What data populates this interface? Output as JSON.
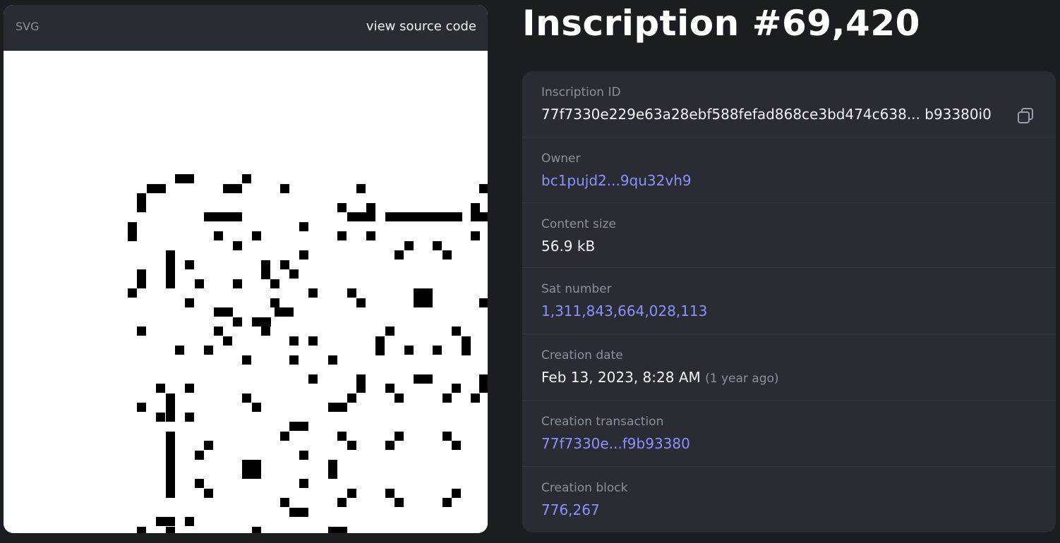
{
  "preview": {
    "type_label": "SVG",
    "source_link": "view source code"
  },
  "title": "Inscription #69,420",
  "details": {
    "inscription_id": {
      "label": "Inscription ID",
      "value": "77f7330e229e63a28ebf588fefad868ce3bd474c638... b93380i0"
    },
    "owner": {
      "label": "Owner",
      "value": "bc1pujd2...9qu32vh9"
    },
    "content_size": {
      "label": "Content size",
      "value": "56.9 kB"
    },
    "sat_number": {
      "label": "Sat number",
      "value": "1,311,843,664,028,113"
    },
    "creation_date": {
      "label": "Creation date",
      "value": "Feb 13, 2023, 8:28 AM",
      "relative": "(1 year ago)"
    },
    "creation_transaction": {
      "label": "Creation transaction",
      "value": "77f7330e...f9b93380"
    },
    "creation_block": {
      "label": "Creation block",
      "value": "776,267"
    }
  },
  "icons": {
    "copy": "copy-icon"
  },
  "colors": {
    "background": "#1c1d21",
    "card": "#2a2c33",
    "link": "#8b91ff",
    "muted": "#8e9099"
  }
}
